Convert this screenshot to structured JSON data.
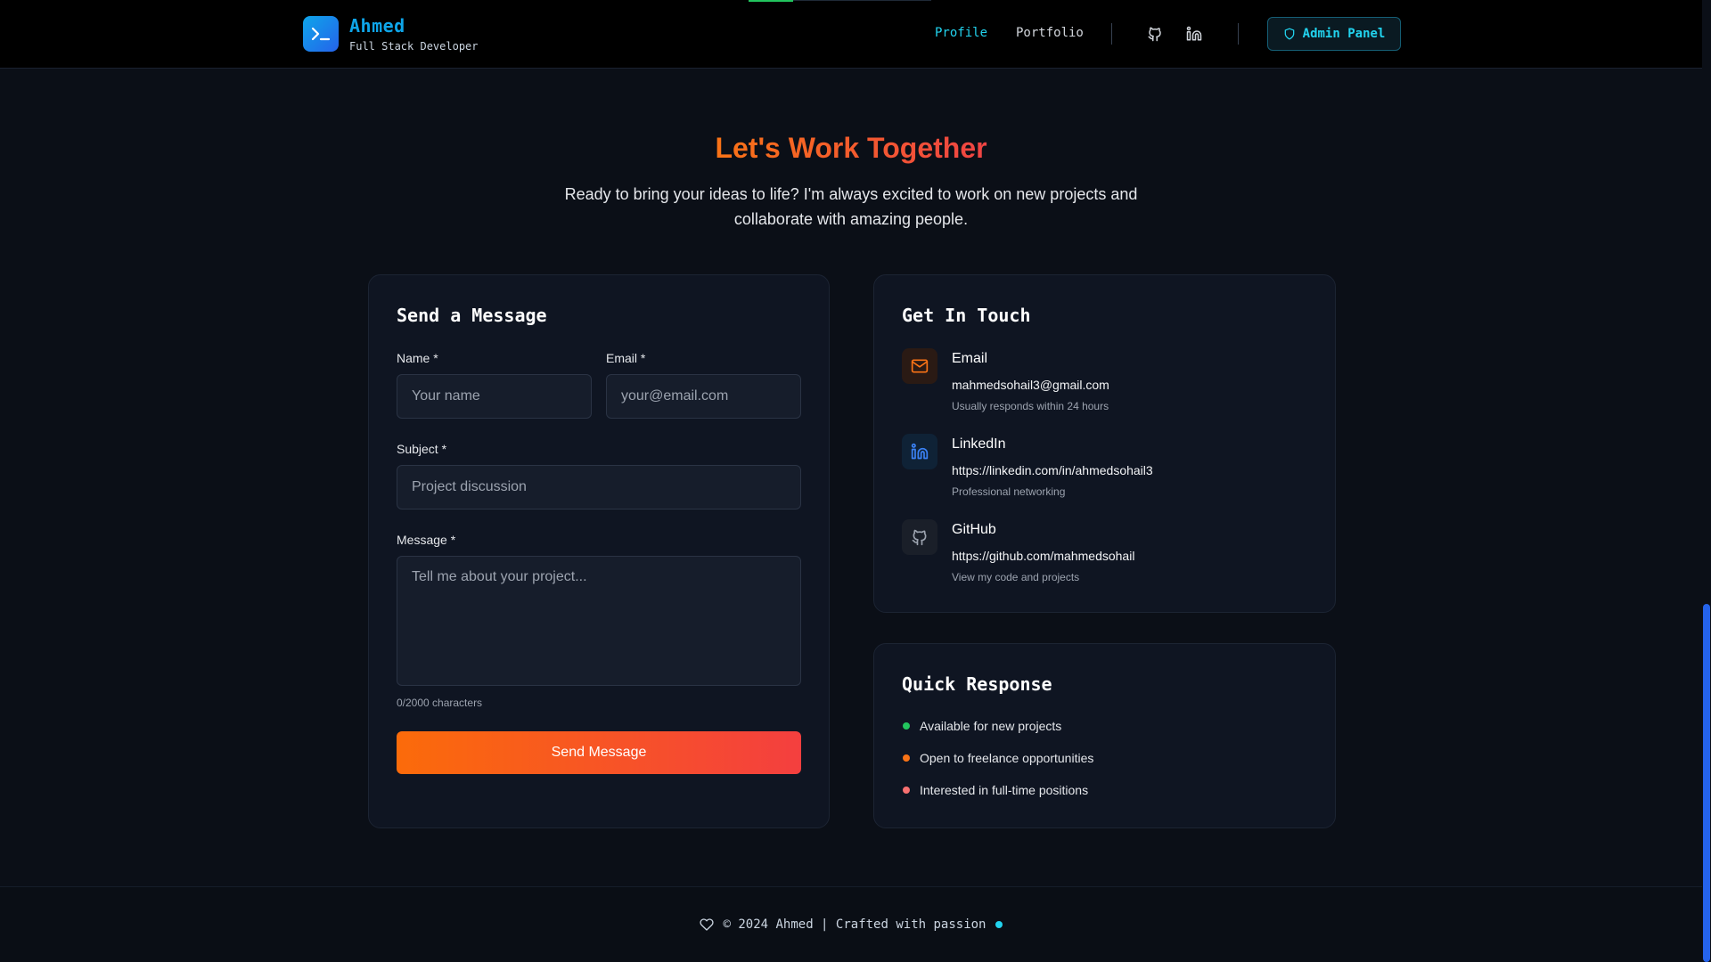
{
  "header": {
    "brand_name": "Ahmed",
    "brand_role": "Full Stack Developer",
    "nav": [
      {
        "label": "Profile",
        "active": true
      },
      {
        "label": "Portfolio",
        "active": false
      }
    ],
    "admin_label": "Admin Panel",
    "accent": "#22d3ee"
  },
  "hero": {
    "title": "Let's Work Together",
    "subtitle": "Ready to bring your ideas to life? I'm always excited to work on new projects and collaborate with amazing people."
  },
  "form": {
    "title": "Send a Message",
    "name_label": "Name *",
    "name_placeholder": "Your name",
    "email_label": "Email *",
    "email_placeholder": "your@email.com",
    "subject_label": "Subject *",
    "subject_placeholder": "Project discussion",
    "message_label": "Message *",
    "message_placeholder": "Tell me about your project...",
    "char_count": "0/2000 characters",
    "submit_label": "Send Message"
  },
  "contact": {
    "title": "Get In Touch",
    "items": [
      {
        "icon": "mail-icon",
        "title": "Email",
        "value": "mahmedsohail3@gmail.com",
        "note": "Usually responds within 24 hours"
      },
      {
        "icon": "linkedin-icon",
        "title": "LinkedIn",
        "value": "https://linkedin.com/in/ahmedsohail3",
        "note": "Professional networking"
      },
      {
        "icon": "github-icon",
        "title": "GitHub",
        "value": "https://github.com/mahmedsohail",
        "note": "View my code and projects"
      }
    ]
  },
  "quick_response": {
    "title": "Quick Response",
    "items": [
      {
        "text": "Available for new projects",
        "color": "#22c55e"
      },
      {
        "text": "Open to freelance opportunities",
        "color": "#f97316"
      },
      {
        "text": "Interested in full-time positions",
        "color": "#f87171"
      }
    ]
  },
  "footer": {
    "text": "© 2024 Ahmed | Crafted with passion"
  }
}
